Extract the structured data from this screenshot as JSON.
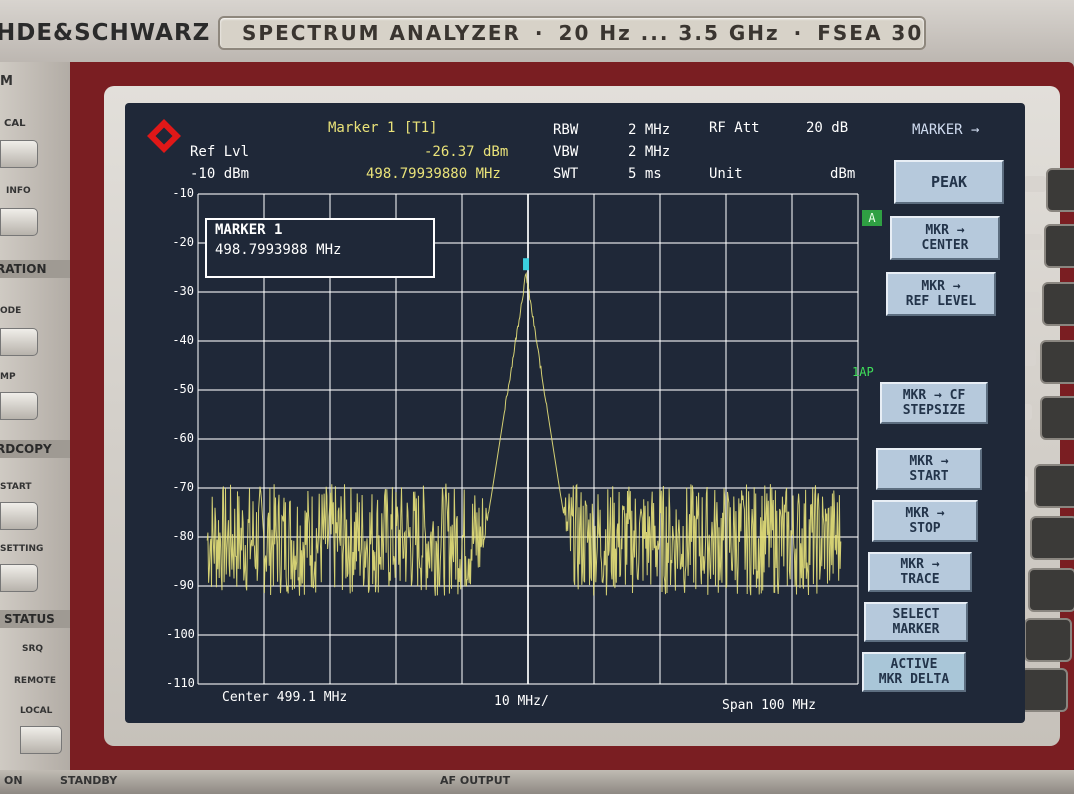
{
  "instrument": {
    "brand": "HDE&SCHWARZ",
    "plate": [
      "SPECTRUM ANALYZER",
      "20 Hz ... 3.5 GHz",
      "FSEA 30"
    ],
    "left_panel": {
      "cal": "CAL",
      "info": "INFO",
      "ration": "RATION",
      "ode": "ODE",
      "mp": "MP",
      "rdcopy": "RDCOPY",
      "start": "START",
      "setting": "SETTING",
      "status": "STATUS",
      "srq": "SRQ",
      "remote": "REMOTE",
      "local": "LOCAL",
      "m": "M"
    },
    "bottom": {
      "on": "ON",
      "standby": "STANDBY",
      "afoutput": "AF OUTPUT"
    }
  },
  "header": {
    "marker_label": "Marker 1 [T1]",
    "marker_level": "-26.37 dBm",
    "marker_freq": "498.79939880 MHz",
    "ref_lvl_label": "Ref Lvl",
    "ref_lvl_value": "-10 dBm",
    "rbw_label": "RBW",
    "rbw_value": "2 MHz",
    "vbw_label": "VBW",
    "vbw_value": "2 MHz",
    "swt_label": "SWT",
    "swt_value": "5 ms",
    "rfatt_label": "RF Att",
    "rfatt_value": "20 dB",
    "unit_label": "Unit",
    "unit_value": "dBm"
  },
  "marker_box": {
    "title": "MARKER 1",
    "freq": "498.7993988 MHz"
  },
  "tags": {
    "a": "A",
    "ap": "1AP"
  },
  "footer": {
    "center": "Center 499.1 MHz",
    "div": "10 MHz/",
    "span": "Span 100 MHz"
  },
  "menu": {
    "title": "MARKER →",
    "softkeys": [
      "PEAK",
      "MKR →\nCENTER",
      "MKR →\nREF LEVEL",
      "MKR → CF\nSTEPSIZE",
      "MKR →\nSTART",
      "MKR →\nSTOP",
      "MKR →\nTRACE",
      "SELECT\nMARKER",
      "ACTIVE\nMKR DELTA"
    ]
  },
  "colors": {
    "trace": "#e8e27a",
    "marker": "#3ad0e0",
    "grid": "#ffffff",
    "screen": "#1f2838"
  },
  "chart_data": {
    "type": "line",
    "title": "",
    "xlabel": "",
    "ylabel": "",
    "y_ticks": [
      "-10",
      "-20",
      "-30",
      "-40",
      "-50",
      "-60",
      "-70",
      "-80",
      "-90",
      "-100",
      "-110"
    ],
    "ylim": [
      -110,
      -10
    ],
    "xlim_mhz": [
      449.1,
      549.1
    ],
    "center_mhz": 499.1,
    "span_mhz": 100,
    "noise_floor_dbm": [
      -92,
      -69
    ],
    "peak": {
      "x_mhz": 498.8,
      "y_dbm": -26.37
    }
  }
}
